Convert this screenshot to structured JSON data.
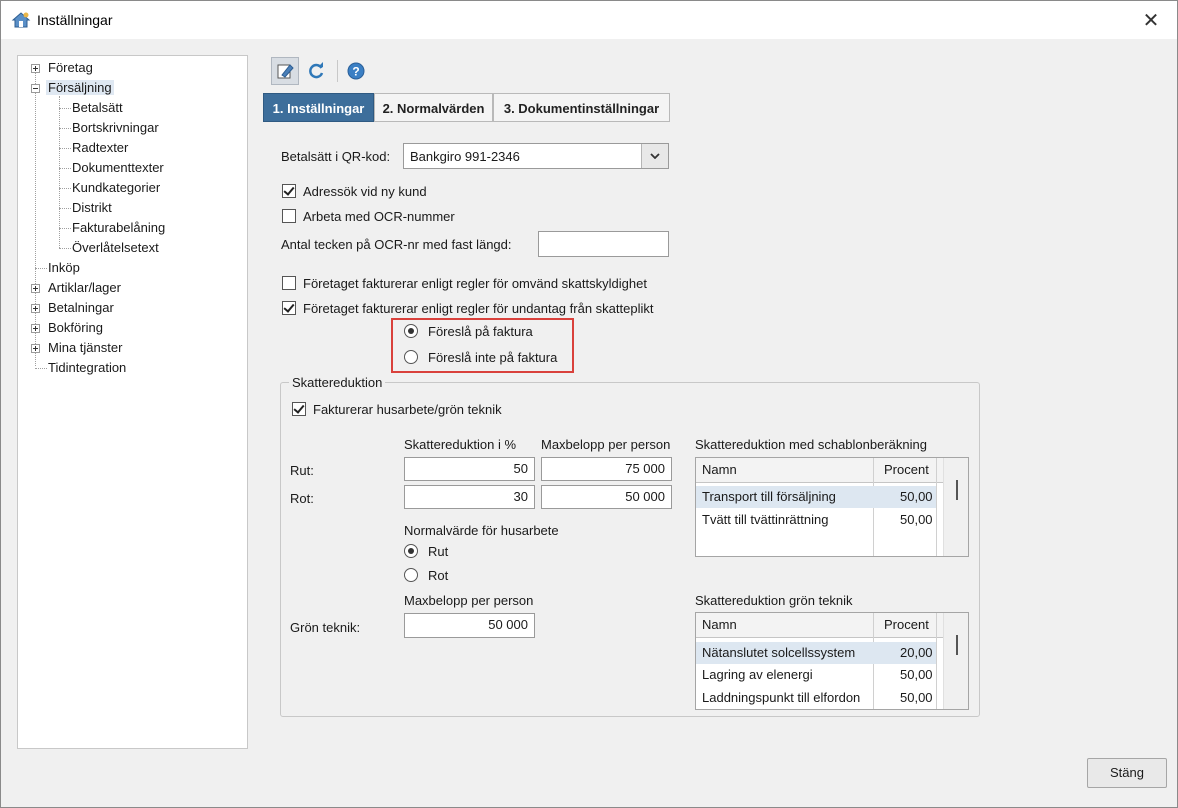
{
  "window": {
    "title": "Inställningar",
    "close_glyph": "✕"
  },
  "tree": {
    "items": [
      {
        "label": "Företag"
      },
      {
        "label": "Försäljning"
      },
      {
        "label": "Betalsätt"
      },
      {
        "label": "Bortskrivningar"
      },
      {
        "label": "Radtexter"
      },
      {
        "label": "Dokumenttexter"
      },
      {
        "label": "Kundkategorier"
      },
      {
        "label": "Distrikt"
      },
      {
        "label": "Fakturabelåning"
      },
      {
        "label": "Överlåtelsetext"
      },
      {
        "label": "Inköp"
      },
      {
        "label": "Artiklar/lager"
      },
      {
        "label": "Betalningar"
      },
      {
        "label": "Bokföring"
      },
      {
        "label": "Mina tjänster"
      },
      {
        "label": "Tidintegration"
      }
    ]
  },
  "toolbar": {
    "icons": [
      "edit-icon",
      "refresh-icon",
      "help-icon"
    ]
  },
  "tabs": [
    {
      "label": "1. Inställningar",
      "active": true
    },
    {
      "label": "2. Normalvärden",
      "active": false
    },
    {
      "label": "3. Dokumentinställningar",
      "active": false
    }
  ],
  "form": {
    "qr_label": "Betalsätt i QR-kod:",
    "qr_value": "Bankgiro 991-2346",
    "adress_label": "Adressök vid ny kund",
    "ocr_label": "Arbeta med OCR-nummer",
    "ocr_len_label": "Antal tecken på OCR-nr med fast längd:",
    "ocr_len_value": "",
    "omvand_label": "Företaget fakturerar enligt regler för omvänd skattskyldighet",
    "undantag_label": "Företaget fakturerar enligt regler för undantag från skatteplikt",
    "foresla_label": "Föreslå på faktura",
    "foresla_inte_label": "Föreslå inte på faktura"
  },
  "skatt": {
    "group_title": "Skattereduktion",
    "husarbete_label": "Fakturerar husarbete/grön teknik",
    "col_procent_hdr": "Skattereduktion i %",
    "col_max_hdr": "Maxbelopp per person",
    "rut_label": "Rut:",
    "rut_procent": "50",
    "rut_max": "75 000",
    "rot_label": "Rot:",
    "rot_procent": "30",
    "rot_max": "50 000",
    "normal_label": "Normalvärde för husarbete",
    "radio_rut": "Rut",
    "radio_rot": "Rot",
    "gron_max_hdr": "Maxbelopp per person",
    "gron_label": "Grön teknik:",
    "gron_max": "50 000"
  },
  "schablon": {
    "title": "Skattereduktion med schablonberäkning",
    "col_namn": "Namn",
    "col_procent": "Procent",
    "rows": [
      {
        "namn": "Transport till försäljning",
        "procent": "50,00"
      },
      {
        "namn": "Tvätt till tvättinrättning",
        "procent": "50,00"
      }
    ]
  },
  "gron": {
    "title": "Skattereduktion grön teknik",
    "col_namn": "Namn",
    "col_procent": "Procent",
    "rows": [
      {
        "namn": "Nätanslutet solcellssystem",
        "procent": "20,00"
      },
      {
        "namn": "Lagring av elenergi",
        "procent": "50,00"
      },
      {
        "namn": "Laddningspunkt till elfordon",
        "procent": "50,00"
      }
    ]
  },
  "footer": {
    "close_label": "Stäng"
  },
  "colors": {
    "active_tab": "#3d6e9b",
    "highlight": "#d9413c",
    "selected_row": "#dde7f1"
  }
}
